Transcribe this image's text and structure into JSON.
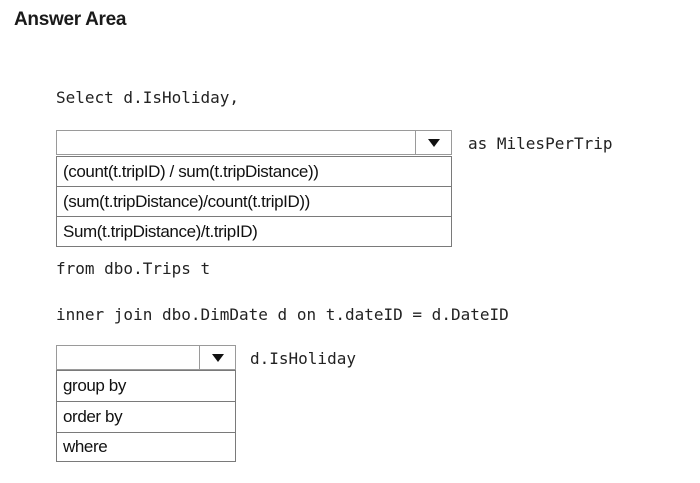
{
  "header": {
    "title": "Answer Area"
  },
  "code": {
    "line_select": "Select d.IsHoliday,",
    "alias": "as MilesPerTrip",
    "line_from": "from dbo.Trips t",
    "line_join": "inner join dbo.DimDate d on t.dateID = d.DateID",
    "trail": "d.IsHoliday"
  },
  "dropdown1": {
    "selected": "",
    "options": [
      "(count(t.tripID) / sum(t.tripDistance))",
      "(sum(t.tripDistance)/count(t.tripID))",
      "Sum(t.tripDistance)/t.tripID)"
    ]
  },
  "dropdown2": {
    "selected": "",
    "options": [
      "group by",
      "order by",
      "where"
    ]
  },
  "icons": {
    "dropdown_arrow": "caret-down-icon"
  }
}
